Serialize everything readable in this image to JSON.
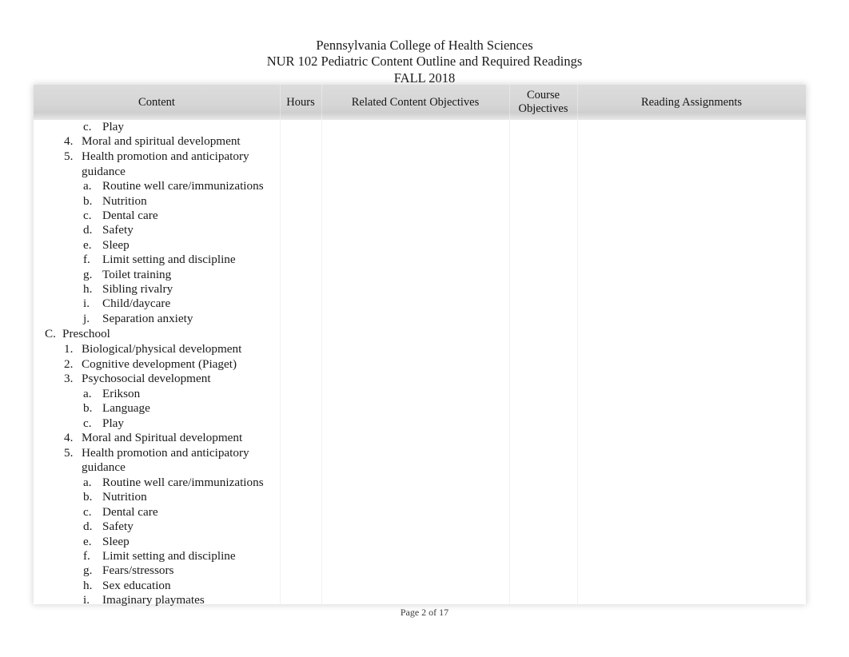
{
  "document": {
    "heading_lines": [
      "Pennsylvania College of Health Sciences",
      "NUR 102 Pediatric Content Outline and Required Readings",
      "FALL 2018"
    ],
    "footer": "Page 2 of 17"
  },
  "table": {
    "columns": [
      {
        "label": "Content",
        "key": "content"
      },
      {
        "label": "Hours",
        "key": "hours"
      },
      {
        "label": "Related Content Objectives",
        "key": "related_content_objectives"
      },
      {
        "label": "Course\nObjectives",
        "key": "course_objectives",
        "label_line1": "Course",
        "label_line2": "Objectives"
      },
      {
        "label": "Reading Assignments",
        "key": "reading_assignments"
      }
    ],
    "cells": {
      "hours": "",
      "related_content_objectives": "",
      "course_objectives": "",
      "reading_assignments": ""
    }
  },
  "outline": [
    {
      "level": "let",
      "marker": "c.",
      "text": "Play"
    },
    {
      "level": "num",
      "marker": "4.",
      "text": "Moral and spiritual development"
    },
    {
      "level": "num",
      "marker": "5.",
      "text": "Health promotion and anticipatory"
    },
    {
      "level": "cont",
      "marker": "",
      "text": "guidance"
    },
    {
      "level": "let",
      "marker": "a.",
      "text": "Routine well care/immunizations"
    },
    {
      "level": "let",
      "marker": "b.",
      "text": "Nutrition"
    },
    {
      "level": "let",
      "marker": "c.",
      "text": "Dental care"
    },
    {
      "level": "let",
      "marker": "d.",
      "text": "Safety"
    },
    {
      "level": "let",
      "marker": "e.",
      "text": "Sleep"
    },
    {
      "level": "let",
      "marker": "f.",
      "text": "Limit setting and discipline"
    },
    {
      "level": "let",
      "marker": "g.",
      "text": "Toilet training"
    },
    {
      "level": "let",
      "marker": "h.",
      "text": "Sibling rivalry"
    },
    {
      "level": "let",
      "marker": "i.",
      "text": "Child/daycare"
    },
    {
      "level": "let",
      "marker": "j.",
      "text": "Separation anxiety"
    },
    {
      "level": "alpha",
      "marker": "C.",
      "text": "Preschool"
    },
    {
      "level": "num",
      "marker": "1.",
      "text": "Biological/physical development"
    },
    {
      "level": "num",
      "marker": "2.",
      "text": "Cognitive development (Piaget)"
    },
    {
      "level": "num",
      "marker": "3.",
      "text": "Psychosocial development"
    },
    {
      "level": "let",
      "marker": "a.",
      "text": "Erikson"
    },
    {
      "level": "let",
      "marker": "b.",
      "text": "Language"
    },
    {
      "level": "let",
      "marker": "c.",
      "text": "Play"
    },
    {
      "level": "num",
      "marker": "4.",
      "text": "Moral and Spiritual development"
    },
    {
      "level": "num",
      "marker": "5.",
      "text": "Health promotion and anticipatory"
    },
    {
      "level": "cont",
      "marker": "",
      "text": "guidance"
    },
    {
      "level": "let",
      "marker": "a.",
      "text": "Routine well care/immunizations"
    },
    {
      "level": "let",
      "marker": "b.",
      "text": "Nutrition"
    },
    {
      "level": "let",
      "marker": "c.",
      "text": "Dental care"
    },
    {
      "level": "let",
      "marker": "d.",
      "text": "Safety"
    },
    {
      "level": "let",
      "marker": "e.",
      "text": "Sleep"
    },
    {
      "level": "let",
      "marker": "f.",
      "text": "Limit setting and discipline"
    },
    {
      "level": "let",
      "marker": "g.",
      "text": "Fears/stressors"
    },
    {
      "level": "let",
      "marker": "h.",
      "text": "Sex education"
    },
    {
      "level": "let",
      "marker": "i.",
      "text": "Imaginary playmates"
    }
  ],
  "layout": {
    "column_x": [
      0,
      308,
      360,
      595,
      680,
      966
    ],
    "colors": {
      "header_band_top": "#dcdcdc",
      "header_band_bottom": "#e8e8e8",
      "column_rule": "#f1f1f2",
      "text": "#1a1a1a",
      "page_background": "#ffffff"
    }
  }
}
